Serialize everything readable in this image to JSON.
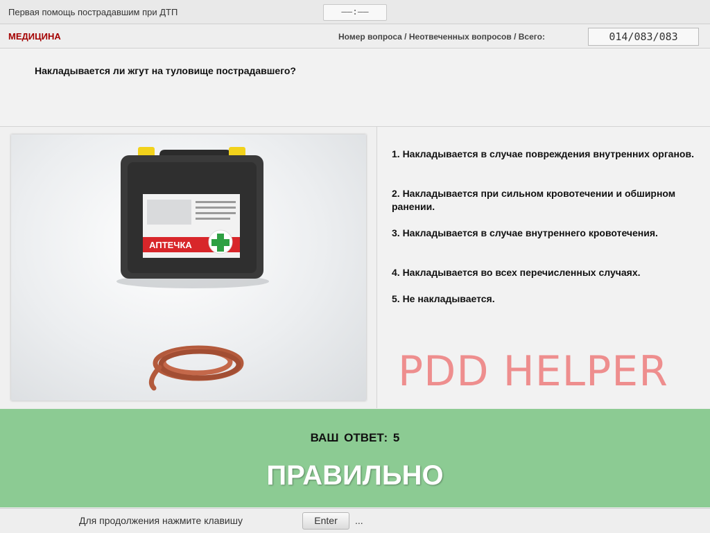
{
  "header": {
    "title": "Первая помощь пострадавшим при ДТП",
    "timer": "――:――"
  },
  "subheader": {
    "category": "МЕДИЦИНА",
    "counter_label": "Номер вопроса / Неотвеченных вопросов / Всего:",
    "counter_value": "014/083/083"
  },
  "question": {
    "text": "Накладывается ли жгут на туловище пострадавшего?"
  },
  "image": {
    "kit_label": "АПТЕЧКА",
    "icons": [
      "first-aid-kit",
      "tourniquet"
    ]
  },
  "answers": [
    "1.  Накладывается в случае повреждения внутренних органов.",
    "2.  Накладывается при сильном кровотечении и обширном ранении.",
    "3.  Накладывается в случае внутреннего кровотечения.",
    "4.  Накладывается во всех перечисленных случаях.",
    "5.  Не накладывается."
  ],
  "watermark": "PDD HELPER",
  "result": {
    "your_answer_label": "ВАШ ОТВЕТ:",
    "your_answer_value": "5",
    "verdict": "ПРАВИЛЬНО",
    "color": "#8ccb93"
  },
  "footer": {
    "hint": "Для продолжения нажмите клавишу",
    "key": "Enter",
    "dots": "..."
  },
  "colors": {
    "category": "#a40000",
    "watermark": "#ee8e8e"
  }
}
